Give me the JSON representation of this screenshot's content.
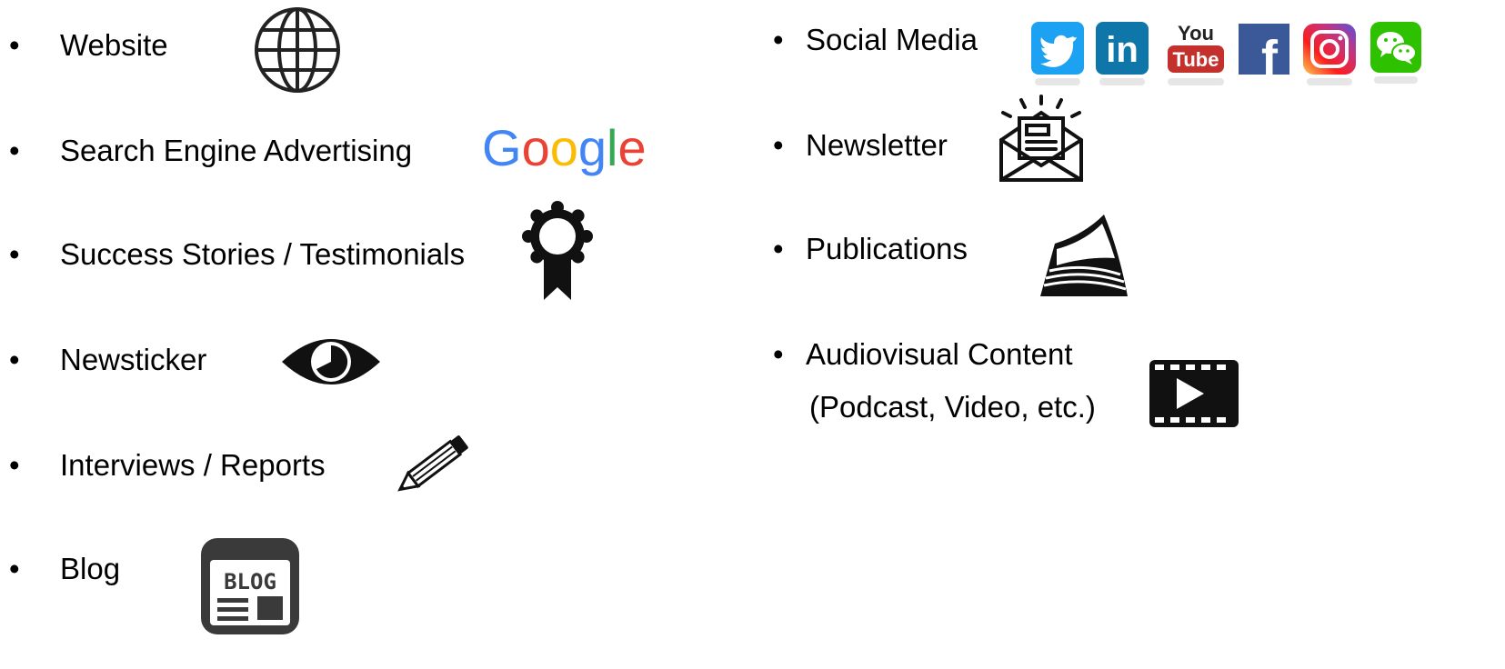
{
  "bullet": "•",
  "left_items": [
    {
      "label": "Website",
      "icon": "globe-icon"
    },
    {
      "label": "Search Engine Advertising",
      "icon": "google-logo"
    },
    {
      "label": "Success Stories / Testimonials",
      "icon": "award-ribbon-icon"
    },
    {
      "label": "Newsticker",
      "icon": "eye-icon"
    },
    {
      "label": "Interviews / Reports",
      "icon": "pencil-icon"
    },
    {
      "label": "Blog",
      "icon": "blog-icon"
    }
  ],
  "right_items": [
    {
      "label": "Social Media",
      "icon": "social-media-icons"
    },
    {
      "label": "Newsletter",
      "icon": "newsletter-envelope-icon"
    },
    {
      "label": "Publications",
      "icon": "publications-magazine-icon"
    },
    {
      "label": "Audiovisual Content",
      "label_line2": "(Podcast, Video, etc.)",
      "icon": "video-film-icon"
    }
  ],
  "logos": {
    "google": "Google",
    "youtube_line1": "You",
    "youtube_line2": "Tube",
    "linkedin": "in",
    "facebook": "f",
    "blog": "BLOG"
  },
  "colors": {
    "text": "#000000",
    "google_blue": "#4285F4",
    "google_red": "#EA4335",
    "google_yellow": "#FBBC05",
    "google_green": "#34A853",
    "twitter": "#1DA1F2",
    "linkedin": "#0E76A8",
    "youtube": "#C4302B",
    "facebook": "#3B5998",
    "wechat": "#2DC100"
  }
}
